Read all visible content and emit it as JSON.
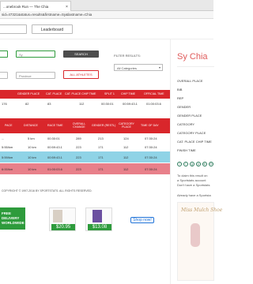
{
  "browser": {
    "tab_title": "...onebrook Run — The Chia",
    "tab_close": "×",
    "address": "sid=47321&status=results&firstname=Sy&lastname=Chia"
  },
  "nav": {
    "leaderboard": "Leaderboard"
  },
  "search": {
    "first_name_value": "",
    "last_name_value": "Sy",
    "province_placeholder": "Province",
    "search_label": "SEARCH",
    "all_athletes_label": "ALL ATHLETES",
    "filter_label": "FILTER RESULTS:",
    "filter_value": "All Categories"
  },
  "results_table": {
    "headers": [
      "GENDER PLACE",
      "CAT. PLACE",
      "CAT. PLACE CHIP TIME",
      "SPLIT 1",
      "CHIP TIME",
      "OFFICIAL TIME"
    ],
    "row": [
      "176",
      "82",
      "83",
      "112",
      "00:30:01",
      "00:59:43.1",
      "01:00:03.6"
    ]
  },
  "splits_table": {
    "headers": [
      "PACE",
      "DISTANCE",
      "RACE TIME",
      "OVERALL CHANGE",
      "GENDER (RESTL)",
      "CATEGORY PLACE",
      "TIME OF DAY"
    ],
    "rows": [
      [
        "...",
        "5 km",
        "00:30:01",
        "289",
        "213",
        "124",
        "07:30:24"
      ],
      [
        "5:55/km",
        "10 km",
        "00:59:43.1",
        "223",
        "171",
        "112",
        "07:30:24"
      ],
      [
        "5:59/km",
        "10 km",
        "00:59:43.1",
        "223",
        "171",
        "112",
        "07:30:24"
      ],
      [
        "6:00/km",
        "10 km",
        "01:00:03.6",
        "223",
        "171",
        "112",
        "07:30:24"
      ]
    ]
  },
  "footer": {
    "copyright": "COPYRIGHT © 1997-2016 BY SPORTSTATS. ALL RIGHTS RESERVED."
  },
  "sidebar": {
    "name": "Sy Chia",
    "fields": [
      "OVERALL PLACE",
      "BIB",
      "REP",
      "GENDER",
      "GENDER PLACE",
      "CATEGORY",
      "CATEGORY PLACE",
      "CAT. PLACE CHIP TIME",
      "FINISH TIME"
    ],
    "social_icons": [
      "f",
      "t",
      "g",
      "p",
      "in",
      "✉"
    ],
    "claim_text": [
      "To claim this result on",
      "a Sportstats account",
      "Don't have a Sportstats"
    ],
    "already_text": "Already have a Sportsta"
  },
  "ad": {
    "banner": [
      "FREE DELIVERY",
      "WORLDWIDE"
    ],
    "prices": [
      "$20.95",
      "$13.08"
    ],
    "shop_now": "Shop now!",
    "brand_logo": "Miss Mulch Shoe"
  }
}
